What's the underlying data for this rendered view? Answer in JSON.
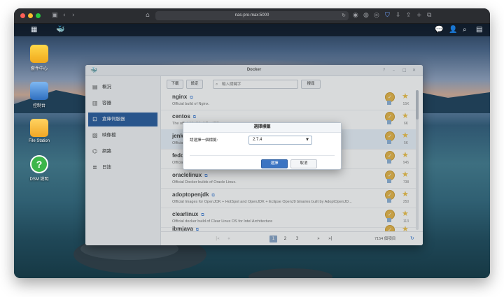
{
  "browser": {
    "address": "nas-pro-max:5000"
  },
  "desktop": {
    "icons": [
      {
        "label": "套件中心"
      },
      {
        "label": "控制台"
      },
      {
        "label": "File Station"
      },
      {
        "label": "DSM 說明"
      }
    ]
  },
  "docker": {
    "title": "Docker",
    "sidebar": {
      "items": [
        {
          "label": "概況"
        },
        {
          "label": "容器"
        },
        {
          "label": "倉庫伺服器"
        },
        {
          "label": "映像檔"
        },
        {
          "label": "網路"
        },
        {
          "label": "日誌"
        }
      ]
    },
    "toolbar": {
      "download_label": "下載",
      "settings_label": "設定",
      "search_placeholder": "輸入關鍵字",
      "manage_label": "搜尋"
    },
    "repositories": [
      {
        "name": "nginx",
        "desc": "Official build of Nginx.",
        "stars": "15K"
      },
      {
        "name": "centos",
        "desc": "The official build of CentOS.",
        "stars": "6K"
      },
      {
        "name": "jenkins",
        "desc": "Official Jenkins Docker image",
        "stars": "5K"
      },
      {
        "name": "fedora",
        "desc": "Official Docker builds of Fedora",
        "stars": "945"
      },
      {
        "name": "oraclelinux",
        "desc": "Official Docker builds of Oracle Linux.",
        "stars": "738"
      },
      {
        "name": "adoptopenjdk",
        "desc": "Official Images for OpenJDK + HotSpot and OpenJDK + Eclipse OpenJ9 binaries built by AdoptOpenJD...",
        "stars": "250"
      },
      {
        "name": "clearlinux",
        "desc": "Official docker build of Clear Linux OS for Intel Architecture",
        "stars": "113"
      },
      {
        "name": "ibmjava",
        "desc": "",
        "stars": ""
      }
    ],
    "pager": {
      "pages": [
        "1",
        "2",
        "3"
      ],
      "current": "1",
      "total": "7154 個項目"
    }
  },
  "modal": {
    "title": "選擇標籤",
    "label": "請選擇一個標籤:",
    "select_value": "2.7.4",
    "confirm_label": "選擇",
    "cancel_label": "取消"
  }
}
